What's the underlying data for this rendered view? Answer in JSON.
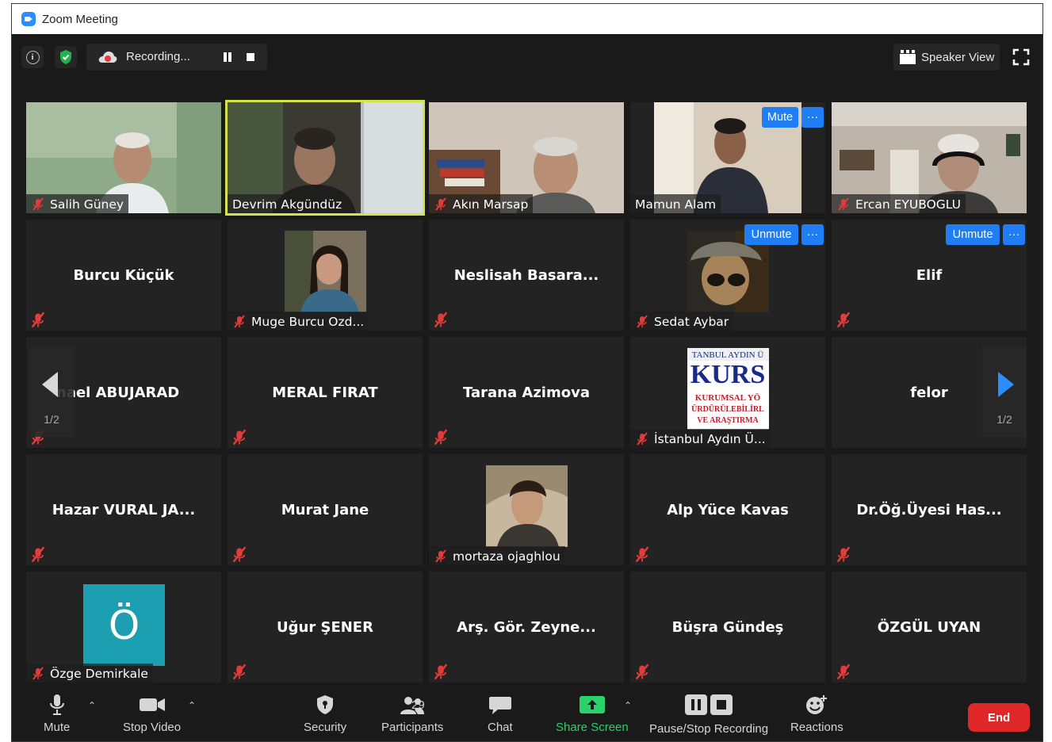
{
  "window": {
    "title": "Zoom Meeting"
  },
  "topbar": {
    "recording_label": "Recording...",
    "speaker_view_label": "Speaker View"
  },
  "tiles": [
    {
      "name": "Salih Güney",
      "kind": "video"
    },
    {
      "name": "Devrim Akgündüz",
      "kind": "video",
      "active": true
    },
    {
      "name": "Akın Marsap",
      "kind": "video"
    },
    {
      "name": "Mamun Alam",
      "kind": "video",
      "buttons": [
        "Mute",
        "···"
      ]
    },
    {
      "name": "Ercan EYUBOGLU",
      "kind": "video"
    },
    {
      "name": "Burcu Küçük",
      "kind": "name"
    },
    {
      "name": "Muge Burcu Ozd...",
      "kind": "photo"
    },
    {
      "name": "Neslisah  Basara...",
      "kind": "name"
    },
    {
      "name": "Sedat Aybar",
      "kind": "photo",
      "buttons": [
        "Unmute",
        "···"
      ]
    },
    {
      "name": "Elif",
      "kind": "name",
      "buttons": [
        "Unmute",
        "···"
      ]
    },
    {
      "name": "nael ABUJARAD",
      "kind": "name"
    },
    {
      "name": "MERAL FIRAT",
      "kind": "name"
    },
    {
      "name": "Tarana Azimova",
      "kind": "name"
    },
    {
      "name": "İstanbul Aydın Ü...",
      "kind": "photo",
      "photo_text": [
        "TANBUL AYDIN Ü",
        "KURS",
        "KURUMSAL YÖ",
        "ÜRDÜRÜLEBİLİRL",
        "VE ARAŞTIRMA"
      ]
    },
    {
      "name": "felor",
      "kind": "name"
    },
    {
      "name": "Hazar VURAL JA...",
      "kind": "name"
    },
    {
      "name": "Murat Jane",
      "kind": "name"
    },
    {
      "name": "mortaza ojaghlou",
      "kind": "photo"
    },
    {
      "name": "Alp Yüce Kavas",
      "kind": "name"
    },
    {
      "name": "Dr.Öğ.Üyesi  Has...",
      "kind": "name"
    },
    {
      "name": "Özge Demirkale",
      "kind": "avatar",
      "initial": "Ö"
    },
    {
      "name": "Uğur ŞENER",
      "kind": "name"
    },
    {
      "name": "Arş. Gör. Zeyne...",
      "kind": "name"
    },
    {
      "name": "Büşra Gündeş",
      "kind": "name"
    },
    {
      "name": "ÖZGÜL UYAN",
      "kind": "name"
    }
  ],
  "pager": {
    "left_page": "1/2",
    "right_page": "1/2"
  },
  "toolbar": {
    "mute_label": "Mute",
    "video_label": "Stop Video",
    "security_label": "Security",
    "participants_label": "Participants",
    "participants_count": "29",
    "chat_label": "Chat",
    "share_label": "Share Screen",
    "recording_label": "Pause/Stop Recording",
    "reactions_label": "Reactions",
    "end_label": "End"
  },
  "colors": {
    "accent_blue": "#1f7ef6",
    "active_speaker": "#d5e34a",
    "share_green": "#27d36a",
    "end_red": "#e02828",
    "muted_red": "#e23b3b",
    "avatar_teal": "#1c9fb0"
  }
}
